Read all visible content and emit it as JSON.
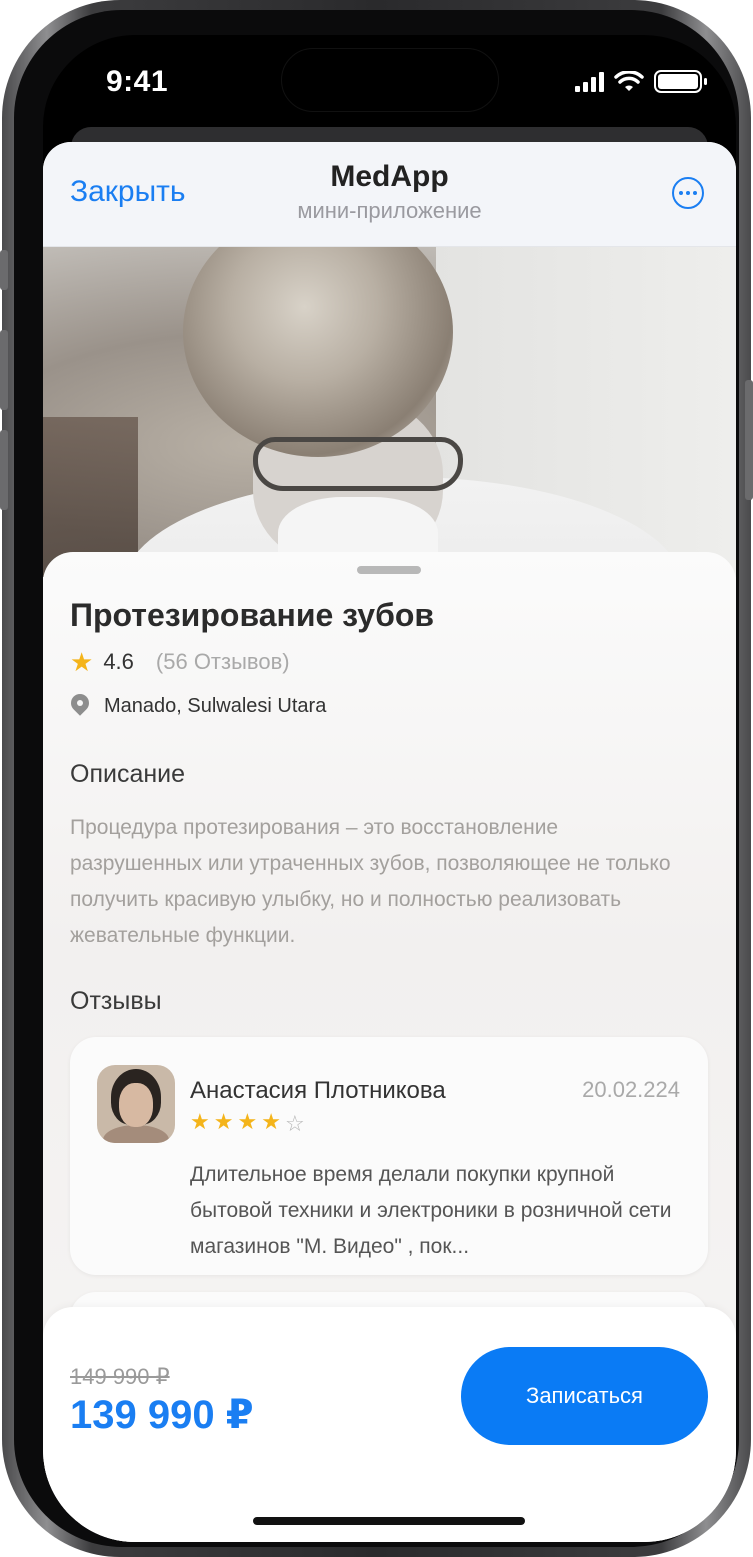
{
  "status_bar": {
    "time": "9:41"
  },
  "nav": {
    "close_label": "Закрыть",
    "title": "MedApp",
    "subtitle": "мини-приложение"
  },
  "service": {
    "title": "Протезирование зубов",
    "rating": "4.6",
    "reviews_count": "(56 Отзывов)",
    "location": "Manado, Sulwalesi Utara"
  },
  "description": {
    "heading": "Описание",
    "text": "Процедура протезирования  – это восстановление разрушенных или утраченных зубов, позволяющее не только получить красивую улыбку, но и полностью реализовать жевательные функции."
  },
  "reviews": {
    "heading": "Отзывы",
    "items": [
      {
        "name": "Анастасия Плотникова",
        "date": "20.02.224",
        "stars": 4,
        "max_stars": 5,
        "text": "Длительное время делали покупки крупной бытовой техники и электроники в розничной сети магазинов \"М. Видео\" , пок..."
      }
    ]
  },
  "booking": {
    "old_price": "149 990 ₽",
    "price": "139 990 ₽",
    "cta_label": "Записаться"
  },
  "colors": {
    "accent": "#1a7ef2",
    "button": "#0a7bf5",
    "star": "#f4b41a"
  },
  "icons": {
    "more": "ellipsis-circle-icon",
    "rating": "star-icon",
    "location": "location-pin-icon"
  }
}
